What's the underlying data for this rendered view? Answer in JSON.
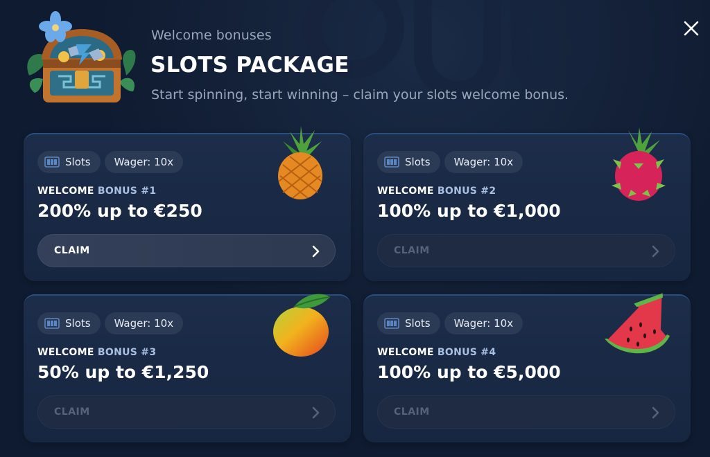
{
  "header": {
    "subtitle": "Welcome bonuses",
    "title": "SLOTS PACKAGE",
    "description": "Start spinning, start winning – claim your slots welcome bonus."
  },
  "close_icon": "close-icon",
  "bonuses": [
    {
      "category": "Slots",
      "wager": "Wager: 10x",
      "label_prefix": "WELCOME",
      "label_suffix": "BONUS #1",
      "amount": "200% up to €250",
      "claim": "CLAIM",
      "claim_state": "active",
      "fruit": "pineapple-icon"
    },
    {
      "category": "Slots",
      "wager": "Wager: 10x",
      "label_prefix": "WELCOME",
      "label_suffix": "BONUS #2",
      "amount": "100% up to €1,000",
      "claim": "CLAIM",
      "claim_state": "disabled",
      "fruit": "dragonfruit-icon"
    },
    {
      "category": "Slots",
      "wager": "Wager: 10x",
      "label_prefix": "WELCOME",
      "label_suffix": "BONUS #3",
      "amount": "50% up to €1,250",
      "claim": "CLAIM",
      "claim_state": "disabled",
      "fruit": "mango-icon"
    },
    {
      "category": "Slots",
      "wager": "Wager: 10x",
      "label_prefix": "WELCOME",
      "label_suffix": "BONUS #4",
      "amount": "100% up to €5,000",
      "claim": "CLAIM",
      "claim_state": "disabled",
      "fruit": "watermelon-icon"
    }
  ],
  "colors": {
    "background": "#0f1b30",
    "card": "#1c2d4a",
    "card_border": "#2b4e82",
    "muted_text": "#9aa6ba",
    "bonus_accent": "#a9c0e3"
  }
}
